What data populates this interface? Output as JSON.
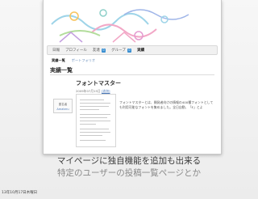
{
  "nav": {
    "items": [
      {
        "label": "日報",
        "badge": ""
      },
      {
        "label": "プロフィール",
        "badge": ""
      },
      {
        "label": "友達",
        "badge": "0"
      },
      {
        "label": "グループ",
        "badge": "0"
      },
      {
        "label": "実績",
        "badge": ""
      }
    ],
    "active_index": 4
  },
  "subtabs": {
    "active": "実績一覧",
    "link": "ポートフォリオ"
  },
  "page_title": "実績一覧",
  "card": {
    "title": "フォントマスター",
    "meta_prefix": "2009年07月15日",
    "meta_link": "[追加]",
    "avatar_name": "匿名者",
    "avatar_link": "Amateru",
    "description": "フォントマスターとは、開発者向けの情報の400種フォントとしても利用可能なフォントを集めました。全日自動、「E」とよ"
  },
  "caption": {
    "line1": "マイページに独自機能を追加も出来る",
    "line2": "特定のユーザーの投稿一覧ページとか"
  },
  "date_stamp": "13年10月17日木曜日",
  "colors": {
    "accent": "#3a8fd1",
    "link": "#4a78b8"
  }
}
